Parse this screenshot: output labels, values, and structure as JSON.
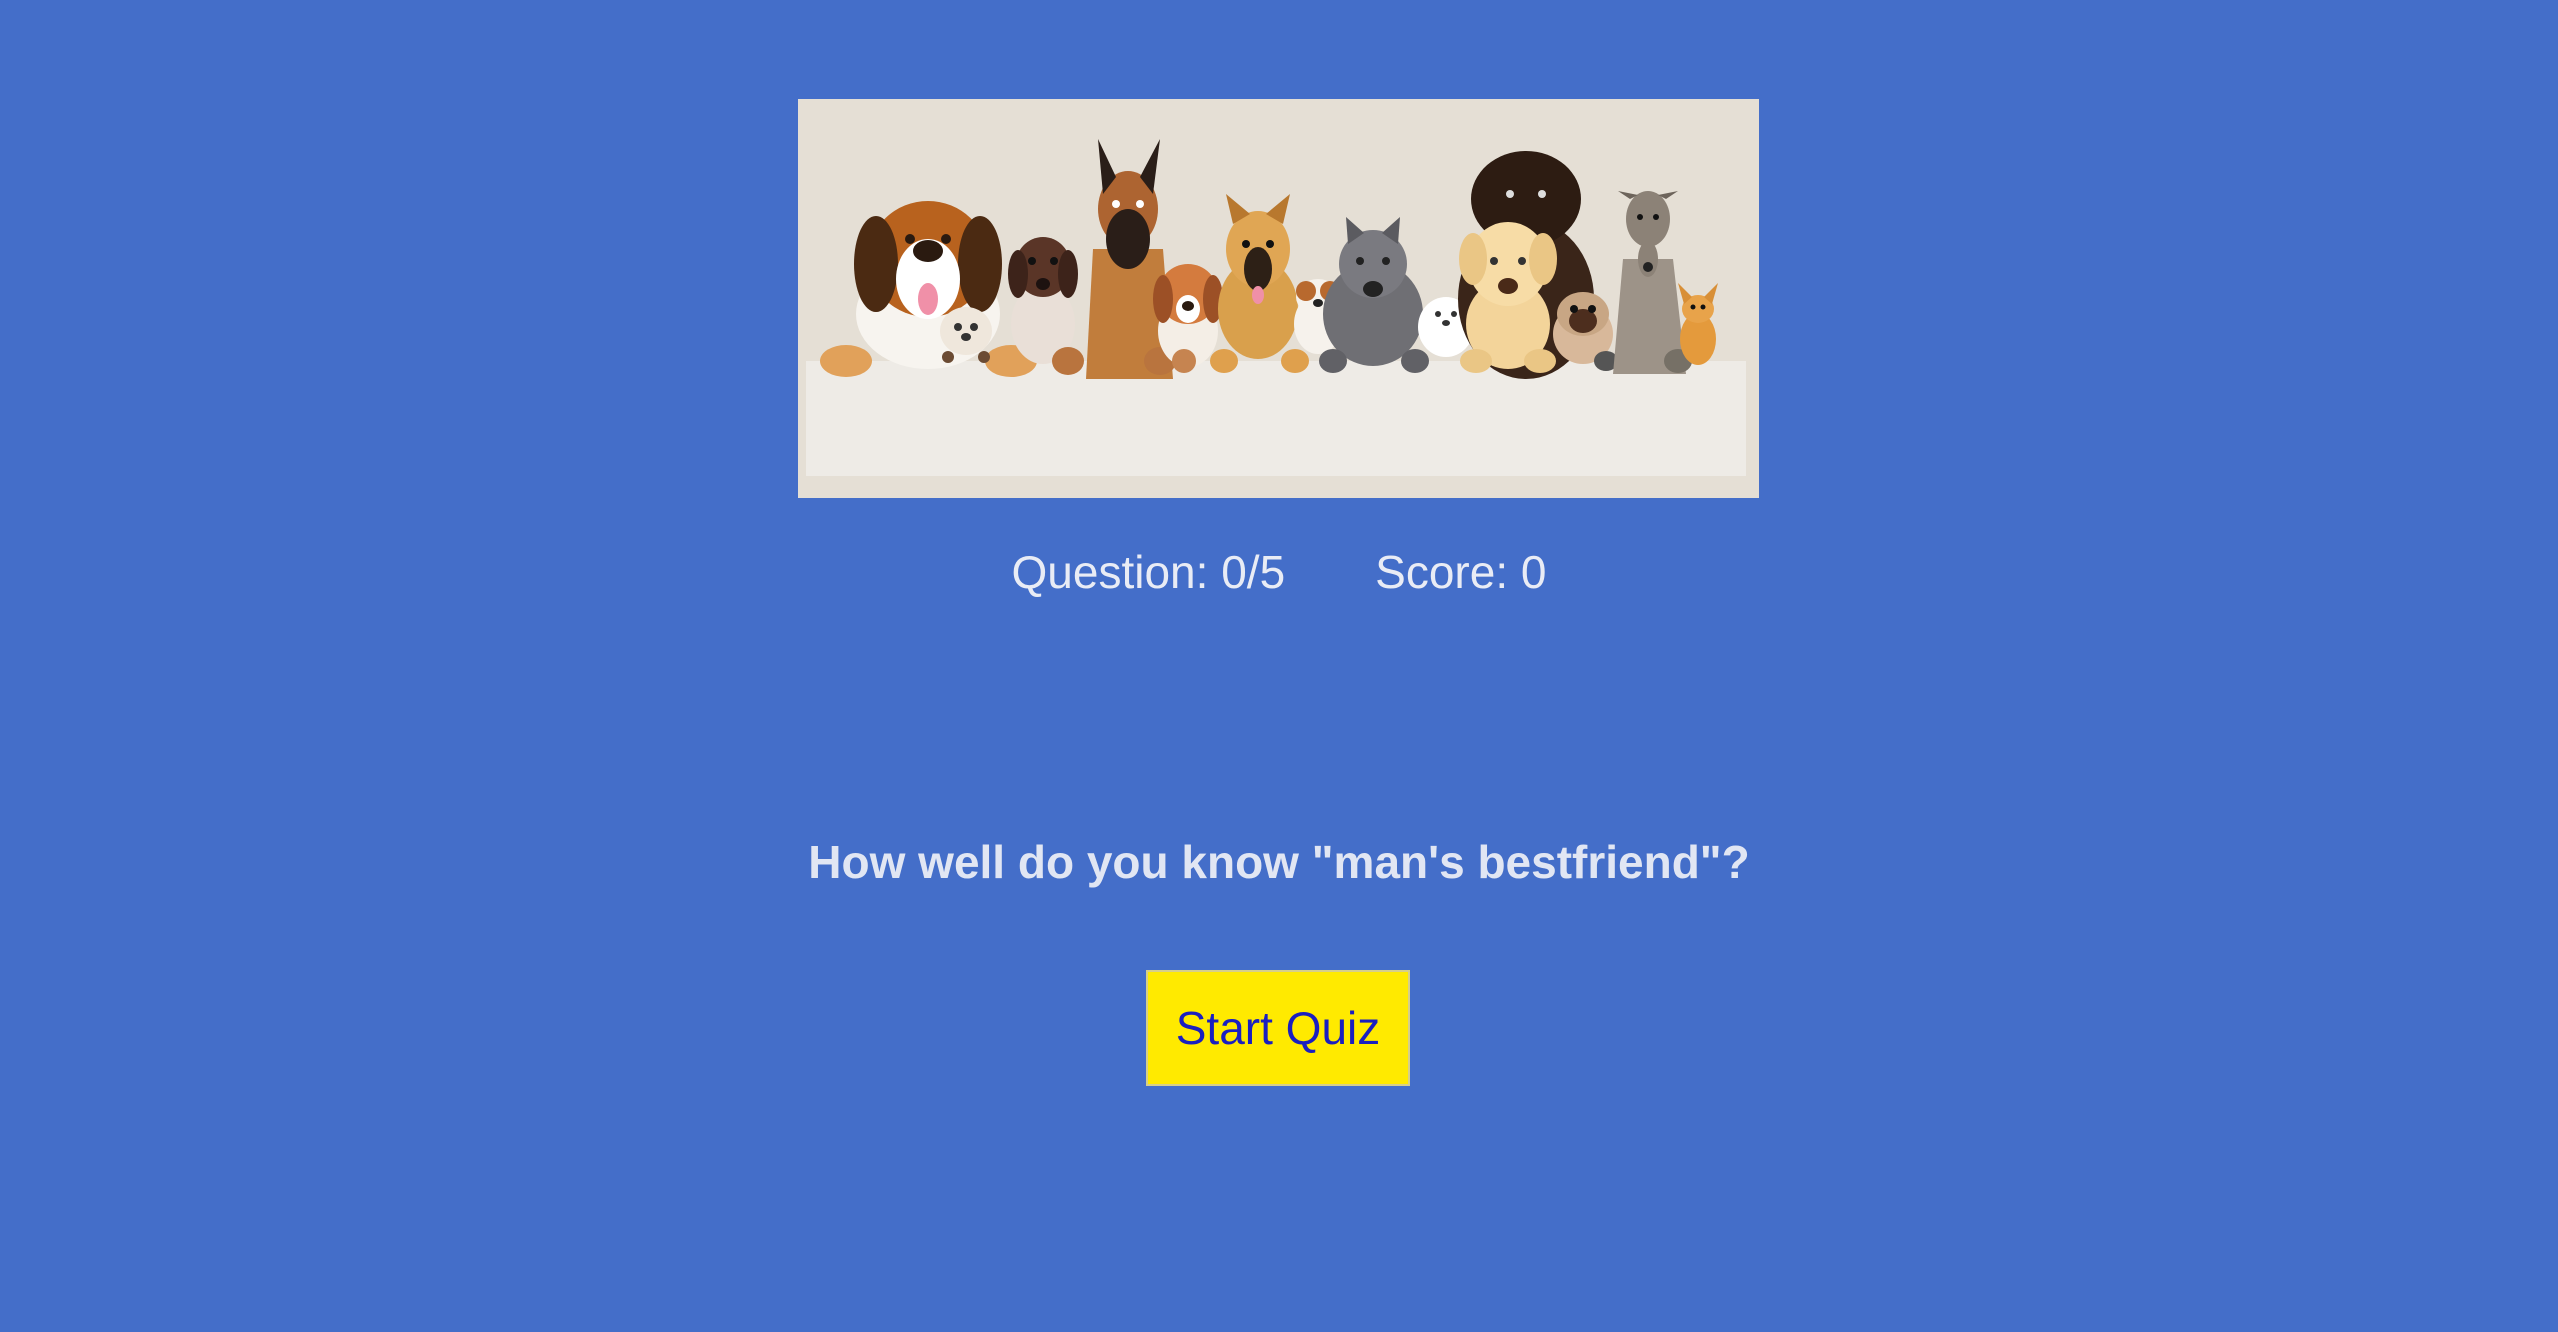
{
  "banner": {
    "image_name": "dog-group-illustration"
  },
  "stats": {
    "question_label": "Question: 0/5",
    "score_label": "Score: 0"
  },
  "intro": {
    "tagline": "How well do you know \"man's bestfriend\"?"
  },
  "actions": {
    "start_label": "Start Quiz"
  },
  "colors": {
    "background": "#446ec9",
    "button": "#ffea00",
    "button_text": "#1a1fc0",
    "text": "#e9ecf5"
  }
}
